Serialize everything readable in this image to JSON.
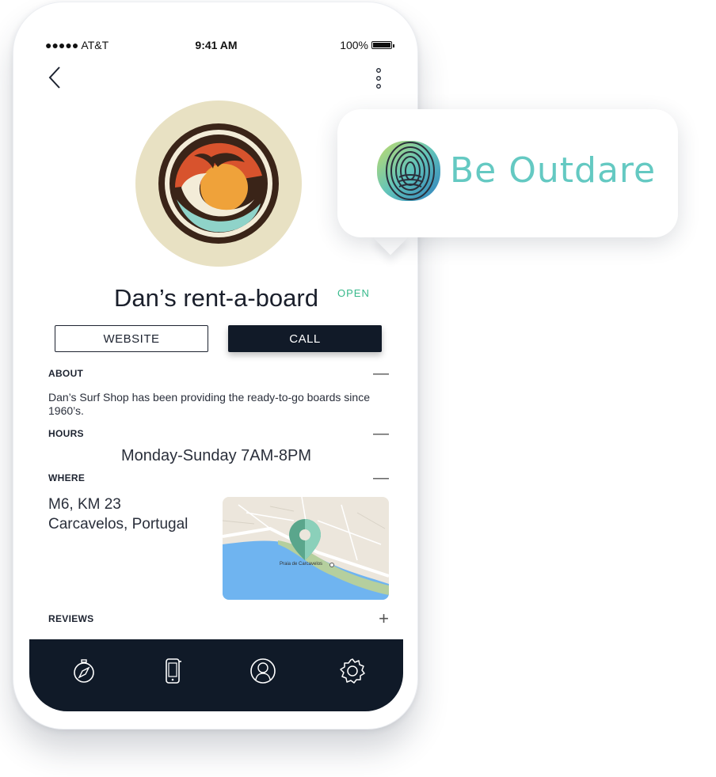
{
  "status_bar": {
    "carrier": "●●●●● AT&T",
    "time": "9:41 AM",
    "battery": "100%"
  },
  "header": {
    "back_icon": "chevron-left-icon",
    "menu_icon": "vertical-dots-icon"
  },
  "shop": {
    "name": "Dan’s rent-a-board",
    "status": "OPEN"
  },
  "actions": {
    "website_label": "WEBSITE",
    "call_label": "CALL"
  },
  "sections": {
    "about": {
      "label": "ABOUT",
      "toggle": "—",
      "text": "Dan’s Surf Shop has been providing the ready-to-go boards since 1960’s."
    },
    "hours": {
      "label": "HOURS",
      "toggle": "—",
      "text": "Monday-Sunday 7AM-8PM"
    },
    "where": {
      "label": "WHERE",
      "toggle": "—",
      "address_line1": "M6, KM 23",
      "address_line2": "Carcavelos, Portugal",
      "map_label": "Praia de Carcavelos"
    },
    "reviews": {
      "label": "REVIEWS",
      "toggle": "+"
    }
  },
  "tab_bar": {
    "icons": [
      "compass-icon",
      "phone-icon",
      "profile-icon",
      "gear-icon"
    ]
  },
  "callout": {
    "brand": "Be Outdare"
  },
  "colors": {
    "accent_green": "#37b98b",
    "dark_navy": "#101a28",
    "brand_teal": "#64c9c2",
    "avatar_bg": "#e8e1c3"
  }
}
